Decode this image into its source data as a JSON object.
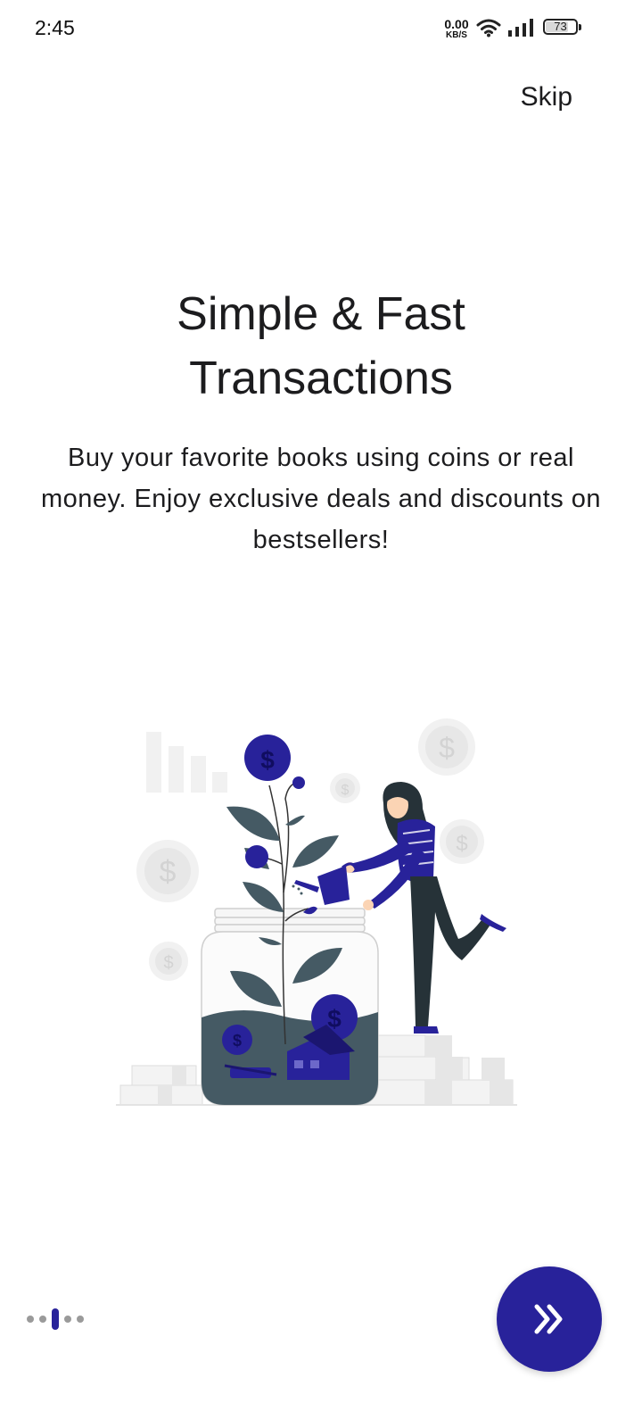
{
  "status_bar": {
    "time": "2:45",
    "net_speed_value": "0.00",
    "net_speed_unit": "KB/S",
    "battery_level": "73",
    "wifi_icon": "wifi-icon",
    "signal_icon": "signal-icon"
  },
  "header": {
    "skip_label": "Skip"
  },
  "onboarding": {
    "title_line1": "Simple & Fast",
    "title_line2": "Transactions",
    "description": "Buy your favorite books using coins or real money. Enjoy exclusive deals and discounts on bestsellers!",
    "illustration": "woman-watering-money-plant-jar",
    "page_count": 5,
    "current_page": 3
  },
  "footer": {
    "next_icon": "double-chevron-right-icon"
  },
  "colors": {
    "accent": "#28229A",
    "text": "#1C1C1E",
    "inactive_dot": "#9A9A9A",
    "jar_water": "#455A64"
  }
}
